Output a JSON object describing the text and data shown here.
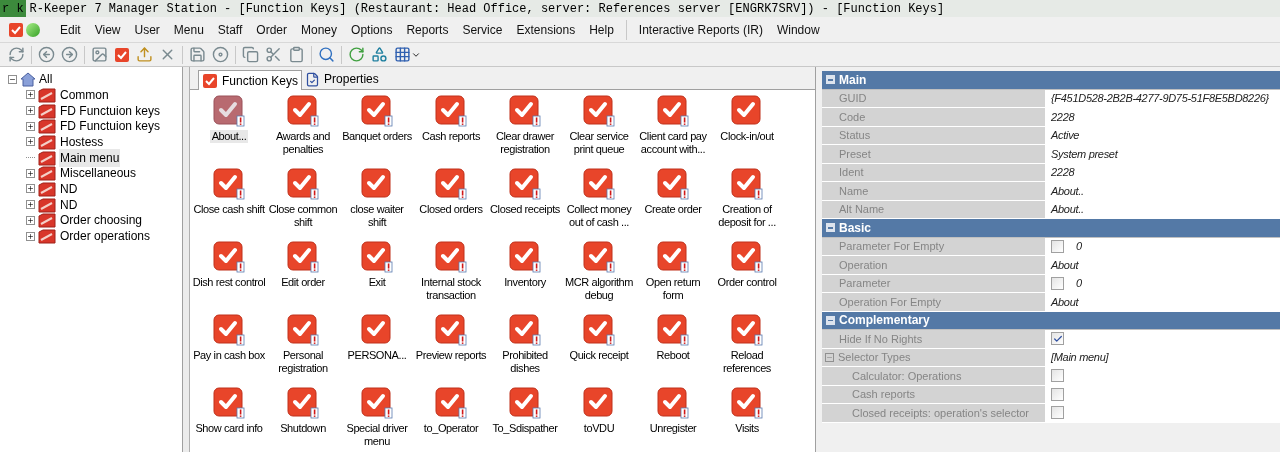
{
  "title_bar": {
    "app_label": "r k",
    "title": "R-Keeper 7 Manager Station - [Function Keys] (Restaurant: Head Office, server: References server [ENGRK7SRV]) - [Function Keys]"
  },
  "menu_bar": [
    "Edit",
    "View",
    "User",
    "Menu",
    "Staff",
    "Order",
    "Money",
    "Options",
    "Reports",
    "Service",
    "Extensions",
    "Help",
    "Interactive Reports (IR)",
    "Window"
  ],
  "tree": {
    "label": "All",
    "expanded": true,
    "children": [
      {
        "label": "Common",
        "has_children": true,
        "selected": false
      },
      {
        "label": "FD Functuion keys",
        "has_children": true,
        "selected": false
      },
      {
        "label": "FD Functuion keys",
        "has_children": true,
        "selected": false
      },
      {
        "label": "Hostess",
        "has_children": true,
        "selected": false
      },
      {
        "label": "Main menu",
        "has_children": false,
        "selected": true
      },
      {
        "label": "Miscellaneous",
        "has_children": true,
        "selected": false
      },
      {
        "label": "ND",
        "has_children": true,
        "selected": false
      },
      {
        "label": "ND",
        "has_children": true,
        "selected": false
      },
      {
        "label": "Order choosing",
        "has_children": true,
        "selected": false
      },
      {
        "label": "Order operations",
        "has_children": true,
        "selected": false
      }
    ]
  },
  "tabs": [
    {
      "label": "Function Keys",
      "selected": true
    },
    {
      "label": "Properties",
      "selected": false
    }
  ],
  "function_keys": [
    {
      "label": "About...",
      "selected": true,
      "flagged": true
    },
    {
      "label": "Awards and penalties",
      "selected": false,
      "flagged": true
    },
    {
      "label": "Banquet orders",
      "selected": false,
      "flagged": true
    },
    {
      "label": "Cash reports",
      "selected": false,
      "flagged": true
    },
    {
      "label": "Clear drawer registration",
      "selected": false,
      "flagged": true
    },
    {
      "label": "Clear service print queue",
      "selected": false,
      "flagged": true
    },
    {
      "label": "Client card pay account with...",
      "selected": false,
      "flagged": true
    },
    {
      "label": "Clock-in/out",
      "selected": false,
      "flagged": false
    },
    {
      "label": "Close cash shift",
      "selected": false,
      "flagged": true
    },
    {
      "label": "Close common shift",
      "selected": false,
      "flagged": true
    },
    {
      "label": "close waiter shift",
      "selected": false,
      "flagged": false
    },
    {
      "label": "Closed orders",
      "selected": false,
      "flagged": true
    },
    {
      "label": "Closed receipts",
      "selected": false,
      "flagged": true
    },
    {
      "label": "Collect money out of cash ...",
      "selected": false,
      "flagged": true
    },
    {
      "label": "Create order",
      "selected": false,
      "flagged": true
    },
    {
      "label": "Creation of deposit for ...",
      "selected": false,
      "flagged": true
    },
    {
      "label": "Dish rest control",
      "selected": false,
      "flagged": true
    },
    {
      "label": "Edit order",
      "selected": false,
      "flagged": true
    },
    {
      "label": "Exit",
      "selected": false,
      "flagged": true
    },
    {
      "label": "Internal stock transaction",
      "selected": false,
      "flagged": true
    },
    {
      "label": "Inventory",
      "selected": false,
      "flagged": true
    },
    {
      "label": "MCR algorithm debug",
      "selected": false,
      "flagged": true
    },
    {
      "label": "Open return form",
      "selected": false,
      "flagged": true
    },
    {
      "label": "Order control",
      "selected": false,
      "flagged": true
    },
    {
      "label": "Pay in cash box",
      "selected": false,
      "flagged": true
    },
    {
      "label": "Personal registration",
      "selected": false,
      "flagged": true
    },
    {
      "label": "PERSONA...",
      "selected": false,
      "flagged": false
    },
    {
      "label": "Preview reports",
      "selected": false,
      "flagged": true
    },
    {
      "label": "Prohibited dishes",
      "selected": false,
      "flagged": true
    },
    {
      "label": "Quick receipt",
      "selected": false,
      "flagged": true
    },
    {
      "label": "Reboot",
      "selected": false,
      "flagged": true
    },
    {
      "label": "Reload references",
      "selected": false,
      "flagged": true
    },
    {
      "label": "Show card info",
      "selected": false,
      "flagged": true
    },
    {
      "label": "Shutdown",
      "selected": false,
      "flagged": true
    },
    {
      "label": "Special driver menu",
      "selected": false,
      "flagged": true
    },
    {
      "label": "to_Operator",
      "selected": false,
      "flagged": true
    },
    {
      "label": "To_Sdispather",
      "selected": false,
      "flagged": true
    },
    {
      "label": "toVDU",
      "selected": false,
      "flagged": false
    },
    {
      "label": "Unregister",
      "selected": false,
      "flagged": true
    },
    {
      "label": "Visits",
      "selected": false,
      "flagged": true
    }
  ],
  "properties": [
    {
      "kind": "section",
      "label": "Main",
      "expanded": true
    },
    {
      "kind": "text",
      "label": "GUID",
      "value": "{F451D528-2B2B-4277-9D75-51F8E5BD8226}"
    },
    {
      "kind": "text",
      "label": "Code",
      "value": "2228"
    },
    {
      "kind": "text",
      "label": "Status",
      "value": "Active"
    },
    {
      "kind": "text",
      "label": "Preset",
      "value": "System preset"
    },
    {
      "kind": "text",
      "label": "Ident",
      "value": "2228"
    },
    {
      "kind": "text",
      "label": "Name",
      "value": "About.."
    },
    {
      "kind": "text",
      "label": "Alt Name",
      "value": "About.."
    },
    {
      "kind": "section",
      "label": "Basic",
      "expanded": true
    },
    {
      "kind": "check",
      "label": "Parameter For Empty",
      "checked": false,
      "value": "0"
    },
    {
      "kind": "text",
      "label": "Operation",
      "value": "About"
    },
    {
      "kind": "check",
      "label": "Parameter",
      "checked": false,
      "value": "0"
    },
    {
      "kind": "text",
      "label": "Operation For Empty",
      "value": "About"
    },
    {
      "kind": "section",
      "label": "Complementary",
      "expanded": true
    },
    {
      "kind": "check",
      "label": "Hide If No Rights",
      "checked": true
    },
    {
      "kind": "group",
      "label": "Selector Types",
      "value": "[Main menu]",
      "expanded": true,
      "children": [
        {
          "kind": "check",
          "label": "Calculator: Operations",
          "checked": false
        },
        {
          "kind": "check",
          "label": "Cash reports",
          "checked": false
        },
        {
          "kind": "check",
          "label": "Closed receipts: operation's selector",
          "checked": false
        }
      ]
    }
  ]
}
